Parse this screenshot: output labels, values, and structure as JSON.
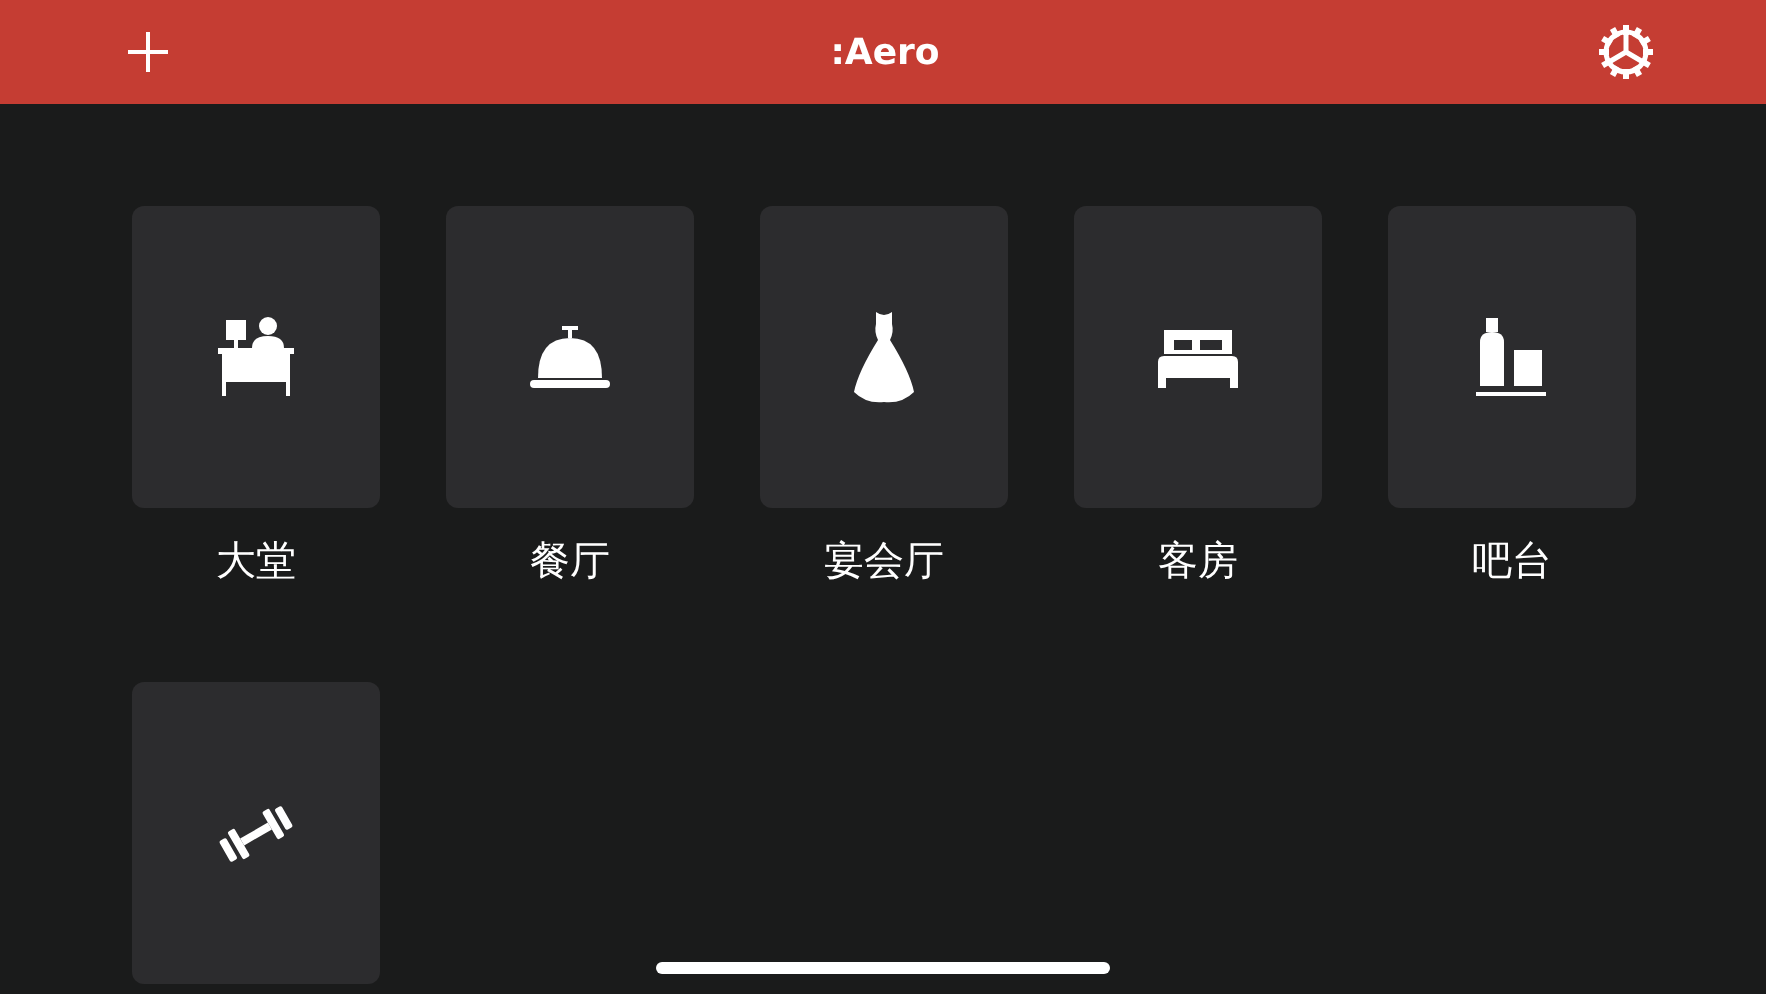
{
  "header": {
    "title": ":Aero"
  },
  "tiles": [
    {
      "kind": "desk",
      "label": "大堂"
    },
    {
      "kind": "bell",
      "label": "餐厅"
    },
    {
      "kind": "dress",
      "label": "宴会厅"
    },
    {
      "kind": "bed",
      "label": "客房"
    },
    {
      "kind": "bar",
      "label": "吧台"
    },
    {
      "kind": "gym"
    }
  ]
}
